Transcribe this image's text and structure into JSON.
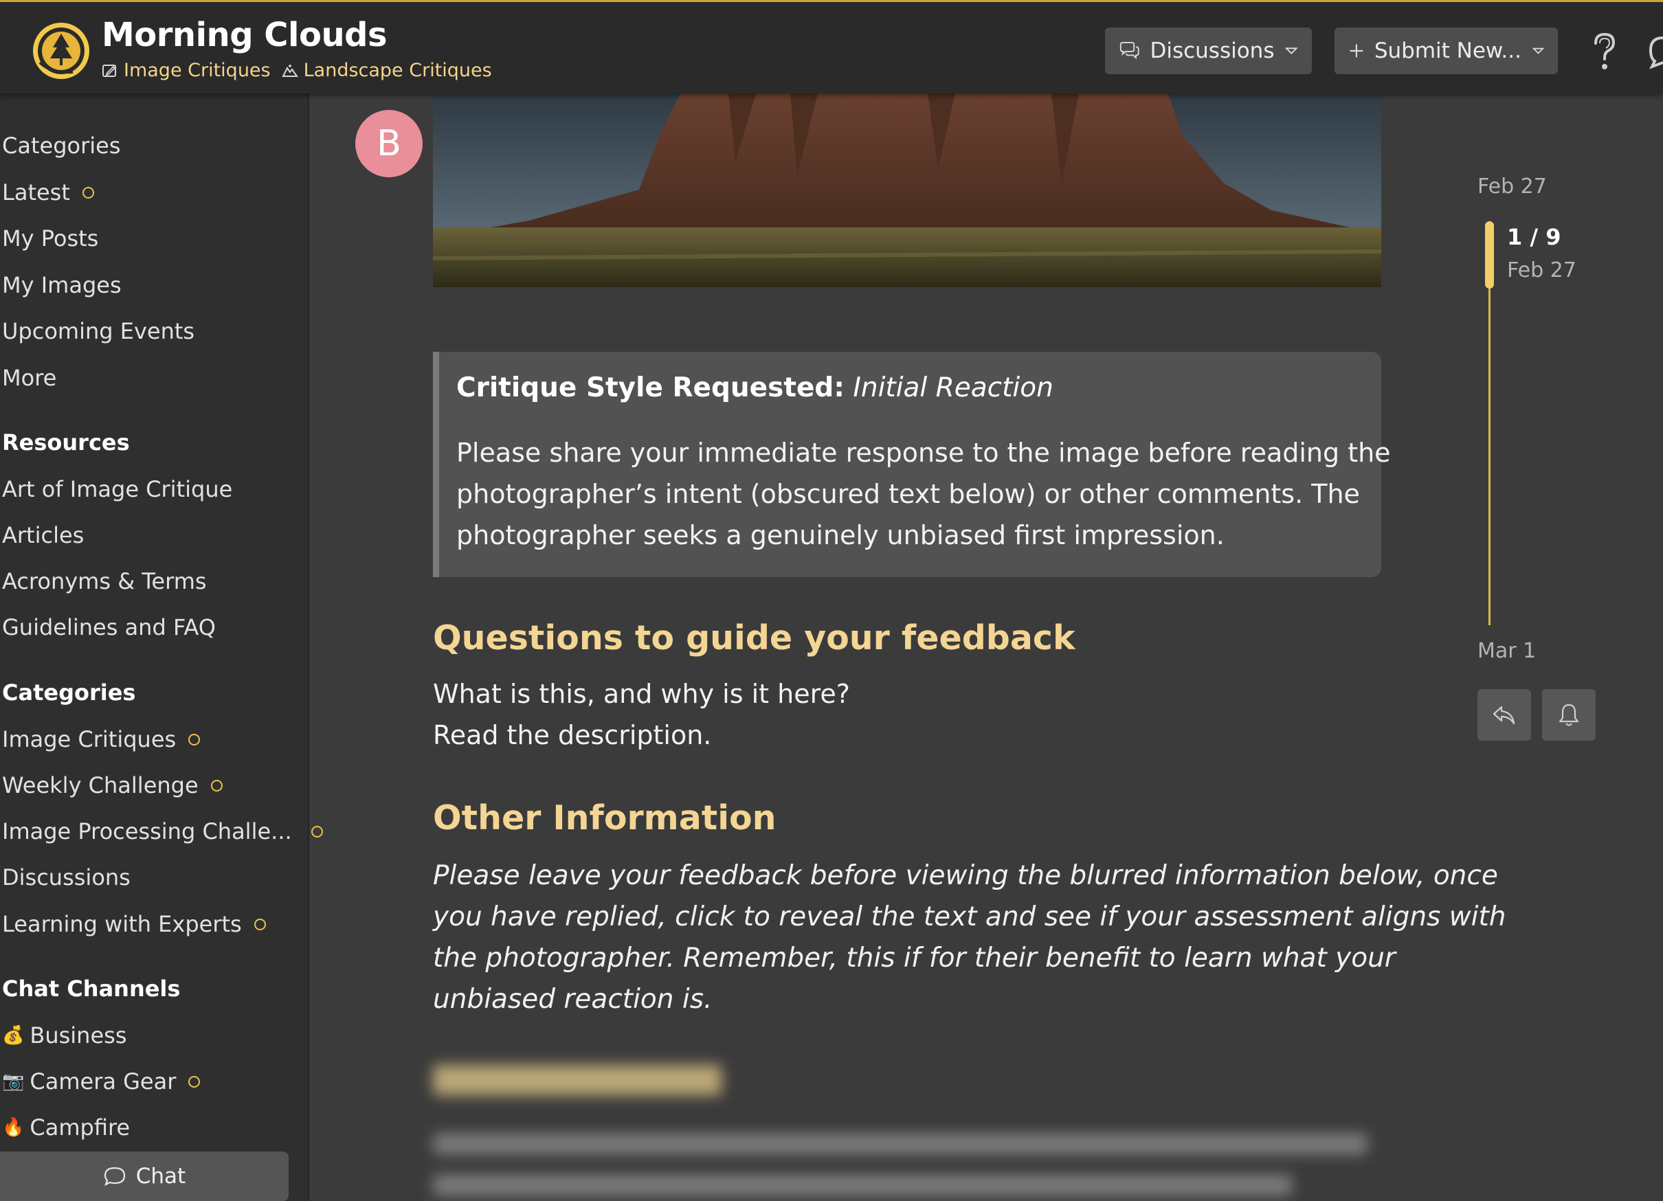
{
  "header": {
    "site_title": "Morning Clouds",
    "breadcrumbs": [
      {
        "label": "Image Critiques",
        "icon": "image-edit-icon"
      },
      {
        "label": "Landscape Critiques",
        "icon": "landscape-icon"
      }
    ],
    "discussions_label": "Discussions",
    "submit_label": "Submit New...",
    "accent_color": "#c9a53b"
  },
  "sidebar": {
    "main_links": [
      "Categories",
      "Latest",
      "My Posts",
      "My Images",
      "Upcoming Events",
      "More"
    ],
    "resources_header": "Resources",
    "resources": [
      "Art of Image Critique",
      "Articles",
      "Acronyms & Terms",
      "Guidelines and FAQ"
    ],
    "categories_header": "Categories",
    "categories": [
      "Image Critiques",
      "Weekly Challenge",
      "Image Processing Challe...",
      "Discussions",
      "Learning with Experts"
    ],
    "chat_header": "Chat Channels",
    "chat_channels": [
      {
        "emoji": "💰",
        "label": "Business"
      },
      {
        "emoji": "📷",
        "label": "Camera Gear"
      },
      {
        "emoji": "🔥",
        "label": "Campfire"
      }
    ],
    "chat_button": "Chat",
    "unread_dot_color": "#e8c44a"
  },
  "post": {
    "avatar_letter": "B",
    "avatar_color": "#e88f9a",
    "callout": {
      "title_bold": "Critique Style Requested:",
      "title_italic": "Initial Reaction",
      "lines": [
        "Please share your immediate response to the image before reading the",
        "photographer’s intent (obscured text below) or other comments. The",
        "photographer seeks a genuinely unbiased first impression."
      ]
    },
    "questions_heading": "Questions to guide your feedback",
    "questions_lines": [
      "What is this, and why is it here?",
      "Read the description."
    ],
    "other_heading": "Other Information",
    "other_lines": [
      "Please leave your feedback before viewing the blurred information below, once",
      "you have replied, click to reveal the text and see if your assessment aligns with",
      "the photographer. Remember, this if for their benefit to learn what your",
      "unbiased reaction is."
    ],
    "heading_color": "#f4d593"
  },
  "timeline": {
    "start_date": "Feb 27",
    "position": "1 / 9",
    "position_date": "Feb 27",
    "end_date": "Mar 1"
  }
}
